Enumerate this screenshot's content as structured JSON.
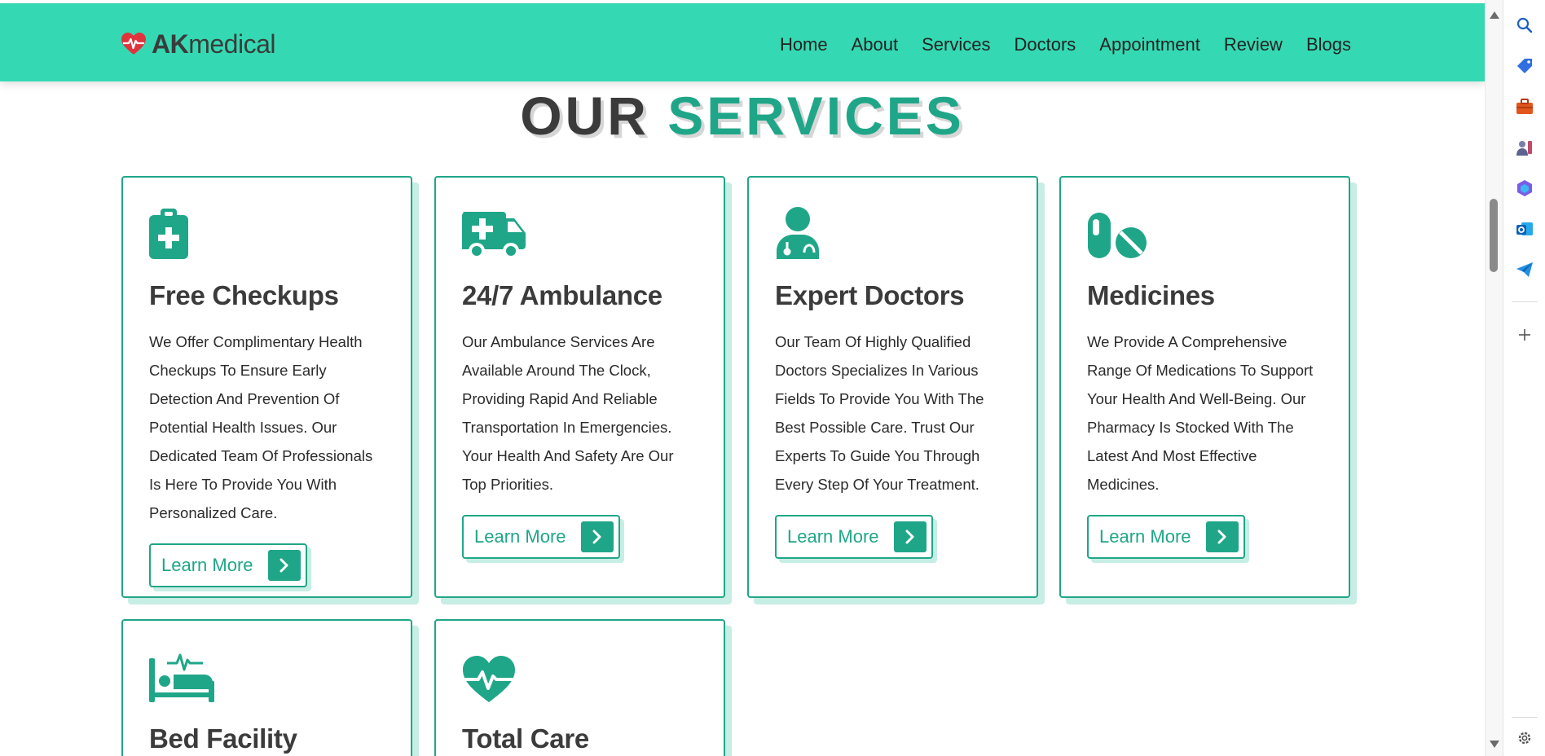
{
  "header": {
    "logo_bold": "AK",
    "logo_rest": "medical",
    "nav": [
      "Home",
      "About",
      "Services",
      "Doctors",
      "Appointment",
      "Review",
      "Blogs"
    ]
  },
  "section": {
    "title_part1": "OUR",
    "title_part2": "SERVICES"
  },
  "services": [
    {
      "icon": "clipboard-medical-icon",
      "title": "Free Checkups",
      "text": "We Offer Complimentary Health Checkups To Ensure Early Detection And Prevention Of Potential Health Issues. Our Dedicated Team Of Professionals Is Here To Provide You With Personalized Care.",
      "button": "Learn More"
    },
    {
      "icon": "ambulance-icon",
      "title": "24/7 Ambulance",
      "text": "Our Ambulance Services Are Available Around The Clock, Providing Rapid And Reliable Transportation In Emergencies. Your Health And Safety Are Our Top Priorities.",
      "button": "Learn More"
    },
    {
      "icon": "doctor-icon",
      "title": "Expert Doctors",
      "text": "Our Team Of Highly Qualified Doctors Specializes In Various Fields To Provide You With The Best Possible Care. Trust Our Experts To Guide You Through Every Step Of Your Treatment.",
      "button": "Learn More"
    },
    {
      "icon": "pills-icon",
      "title": "Medicines",
      "text": "We Provide A Comprehensive Range Of Medications To Support Your Health And Well-Being. Our Pharmacy Is Stocked With The Latest And Most Effective Medicines.",
      "button": "Learn More"
    },
    {
      "icon": "bed-pulse-icon",
      "title": "Bed Facility"
    },
    {
      "icon": "heart-pulse-icon",
      "title": "Total Care"
    }
  ],
  "colors": {
    "header_bg": "#34d9b3",
    "accent": "#1fa688",
    "heading_dark": "#3b3b3b",
    "card_shadow": "#c7eee4"
  },
  "browser_sidebar": {
    "icons": [
      "search-icon",
      "tag-icon",
      "toolbox-icon",
      "games-icon",
      "copilot-icon",
      "outlook-icon",
      "send-icon",
      "add-icon",
      "settings-icon"
    ]
  }
}
